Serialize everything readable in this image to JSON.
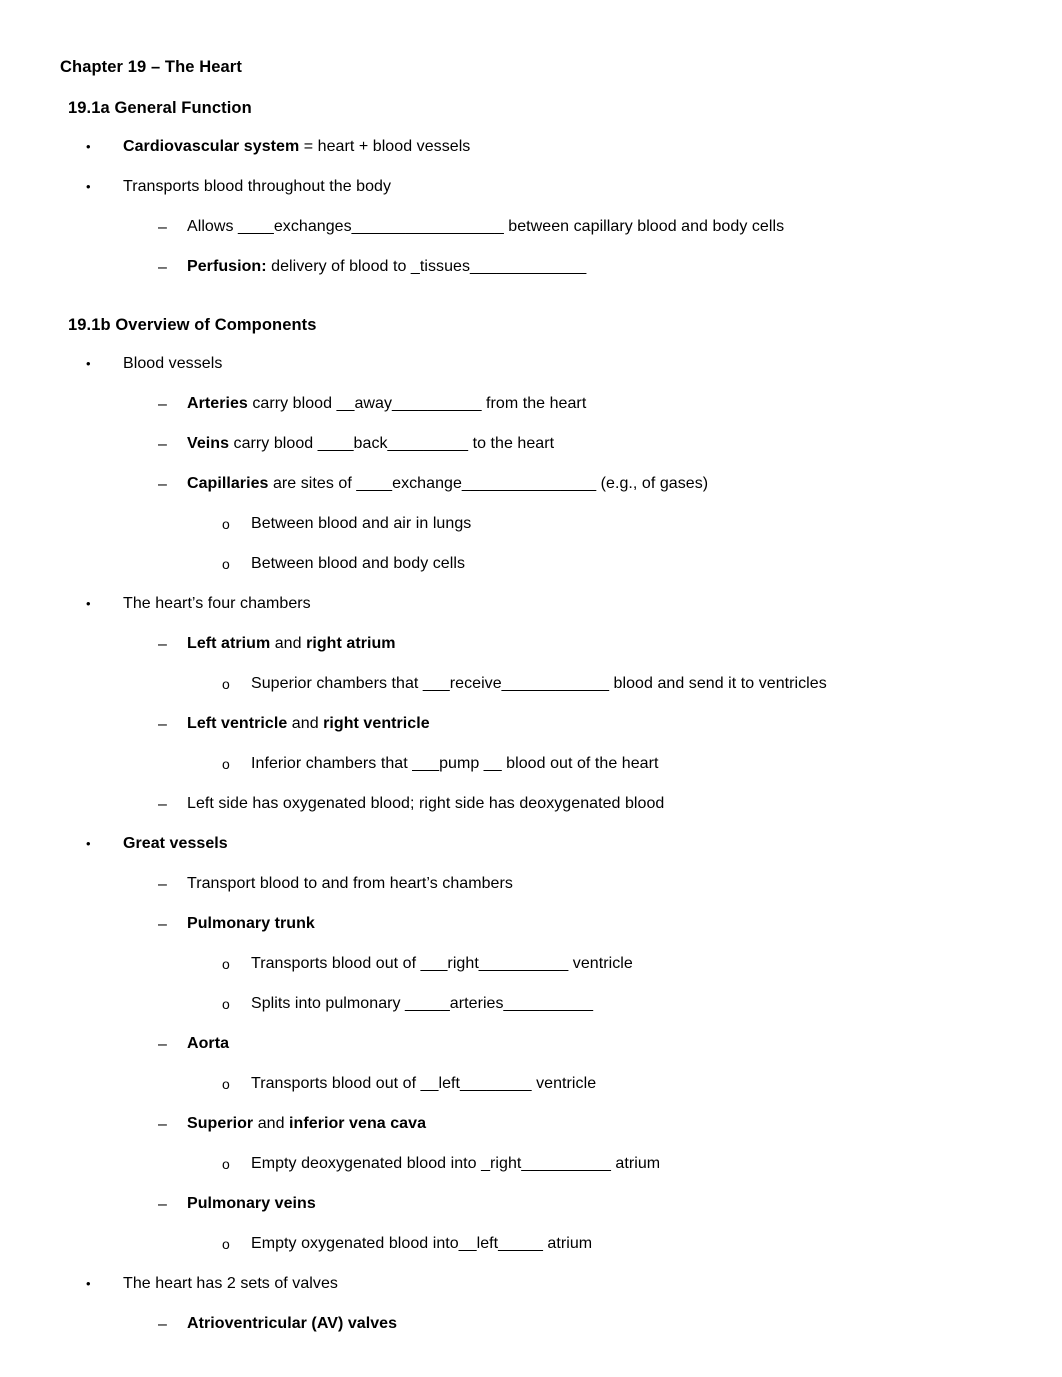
{
  "document": {
    "chapter_title": "Chapter 19 – The Heart",
    "sections": [
      {
        "heading": "19.1a General Function",
        "items": [
          {
            "level": 1,
            "marker": "•",
            "bold_lead": "Cardiovascular system",
            "rest": " = heart + blood vessels"
          },
          {
            "level": 1,
            "marker": "•",
            "bold_lead": "",
            "rest": "Transports blood throughout the body"
          },
          {
            "level": 2,
            "marker": "–",
            "bold_lead": "",
            "rest": "Allows ____exchanges_________________ between capillary blood and body cells"
          },
          {
            "level": 2,
            "marker": "–",
            "bold_lead": "Perfusion:",
            "rest": " delivery of blood to _tissues_____________"
          }
        ]
      },
      {
        "heading": "19.1b Overview of Components",
        "items": [
          {
            "level": 1,
            "marker": "•",
            "bold_lead": "",
            "rest": "Blood vessels"
          },
          {
            "level": 2,
            "marker": "–",
            "bold_lead": "Arteries",
            "rest": " carry blood __away__________ from the heart"
          },
          {
            "level": 2,
            "marker": "–",
            "bold_lead": "Veins",
            "rest": " carry blood ____back_________ to the heart"
          },
          {
            "level": 2,
            "marker": "–",
            "bold_lead": "Capillaries",
            "rest": " are sites of ____exchange_______________ (e.g., of gases)"
          },
          {
            "level": 3,
            "marker": "o",
            "bold_lead": "",
            "rest": "Between blood and air in lungs"
          },
          {
            "level": 3,
            "marker": "o",
            "bold_lead": "",
            "rest": "Between blood and body cells"
          },
          {
            "level": 1,
            "marker": "•",
            "bold_lead": "",
            "rest": "The heart’s four chambers"
          },
          {
            "level": 2,
            "marker": "–",
            "bold_lead": "Left atrium",
            "rest": " and ",
            "bold_tail": "right atrium"
          },
          {
            "level": 3,
            "marker": "o",
            "bold_lead": "",
            "rest": "Superior chambers that ___receive____________ blood and send it to ventricles"
          },
          {
            "level": 2,
            "marker": "–",
            "bold_lead": "Left ventricle",
            "rest": " and ",
            "bold_tail": "right ventricle"
          },
          {
            "level": 3,
            "marker": "o",
            "bold_lead": "",
            "rest": "Inferior chambers that ___pump __ blood out of the heart"
          },
          {
            "level": 2,
            "marker": "–",
            "bold_lead": "",
            "rest": "Left side has oxygenated blood; right side has deoxygenated blood"
          },
          {
            "level": 1,
            "marker": "•",
            "bold_lead": "Great vessels",
            "rest": ""
          },
          {
            "level": 2,
            "marker": "–",
            "bold_lead": "",
            "rest": "Transport blood to and from heart’s chambers"
          },
          {
            "level": 2,
            "marker": "–",
            "bold_lead": "Pulmonary trunk",
            "rest": ""
          },
          {
            "level": 3,
            "marker": "o",
            "bold_lead": "",
            "rest": "Transports blood out of ___right__________ ventricle"
          },
          {
            "level": 3,
            "marker": "o",
            "bold_lead": "",
            "rest": "Splits into pulmonary _____arteries__________"
          },
          {
            "level": 2,
            "marker": "–",
            "bold_lead": "Aorta",
            "rest": ""
          },
          {
            "level": 3,
            "marker": "o",
            "bold_lead": "",
            "rest": "Transports blood out of __left________ ventricle"
          },
          {
            "level": 2,
            "marker": "–",
            "bold_lead": "Superior",
            "rest": " and ",
            "bold_tail": "inferior vena cava"
          },
          {
            "level": 3,
            "marker": "o",
            "bold_lead": "",
            "rest": "Empty deoxygenated blood into _right__________ atrium"
          },
          {
            "level": 2,
            "marker": "–",
            "bold_lead": "Pulmonary veins",
            "rest": ""
          },
          {
            "level": 3,
            "marker": "o",
            "bold_lead": "",
            "rest": "Empty oxygenated blood into__left_____ atrium"
          },
          {
            "level": 1,
            "marker": "•",
            "bold_lead": "",
            "rest": "The heart has 2 sets of valves"
          },
          {
            "level": 2,
            "marker": "–",
            "bold_lead": "Atrioventricular (AV) valves",
            "rest": ""
          }
        ]
      }
    ]
  },
  "colors": {
    "page_background": "#ffffff",
    "text": "#000000"
  }
}
